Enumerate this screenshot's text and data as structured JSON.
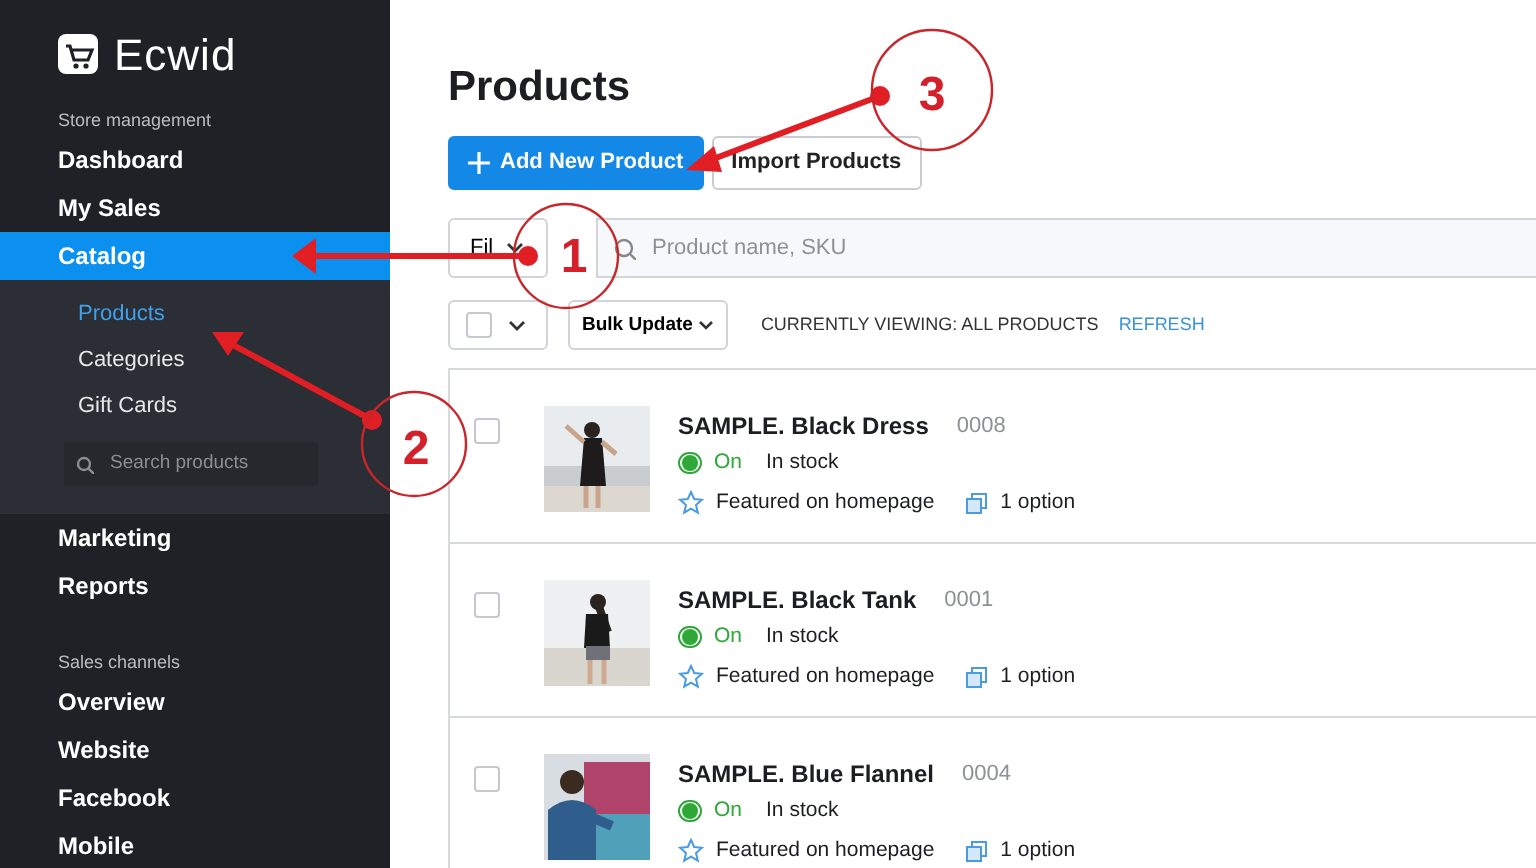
{
  "sidebar": {
    "logo": "Ecwid",
    "groups": [
      {
        "heading": "Store management",
        "items": [
          {
            "label": "Dashboard",
            "selected": false
          },
          {
            "label": "My Sales",
            "selected": false
          },
          {
            "label": "Catalog",
            "selected": true,
            "children": [
              {
                "label": "Products",
                "selected": true
              },
              {
                "label": "Categories",
                "selected": false
              },
              {
                "label": "Gift Cards",
                "selected": false
              }
            ],
            "search": {
              "placeholder": "Search products"
            }
          },
          {
            "label": "Marketing",
            "selected": false
          },
          {
            "label": "Reports",
            "selected": false
          }
        ]
      },
      {
        "heading": "Sales channels",
        "items": [
          {
            "label": "Overview",
            "selected": false
          },
          {
            "label": "Website",
            "selected": false
          },
          {
            "label": "Facebook",
            "selected": false
          },
          {
            "label": "Mobile",
            "selected": false
          }
        ]
      }
    ]
  },
  "page_title": "Products",
  "buttons": [
    {
      "label": "Add New Product",
      "kind": "primary"
    },
    {
      "label": "Import Products",
      "kind": "secondary"
    }
  ],
  "filter": {
    "label": "Fil",
    "search_placeholder": "Product name, SKU"
  },
  "bulk": {
    "select_all_checked": false,
    "bulk_label": "Bulk Update",
    "viewing": "CURRENTLY VIEWING: ALL PRODUCTS",
    "refresh": "REFRESH"
  },
  "products": [
    {
      "name": "SAMPLE. Black Dress",
      "sku": "0008",
      "enabled": true,
      "status": "On",
      "stock": "In stock",
      "featured": "Featured on homepage",
      "options": "1 option",
      "checked": false
    },
    {
      "name": "SAMPLE. Black Tank",
      "sku": "0001",
      "enabled": true,
      "status": "On",
      "stock": "In stock",
      "featured": "Featured on homepage",
      "options": "1 option",
      "checked": false
    },
    {
      "name": "SAMPLE. Blue Flannel",
      "sku": "0004",
      "enabled": true,
      "status": "On",
      "stock": "In stock",
      "featured": "Featured on homepage",
      "options": "1 option",
      "checked": false
    }
  ],
  "annotations": [
    {
      "label": "1"
    },
    {
      "label": "2"
    },
    {
      "label": "3"
    }
  ]
}
